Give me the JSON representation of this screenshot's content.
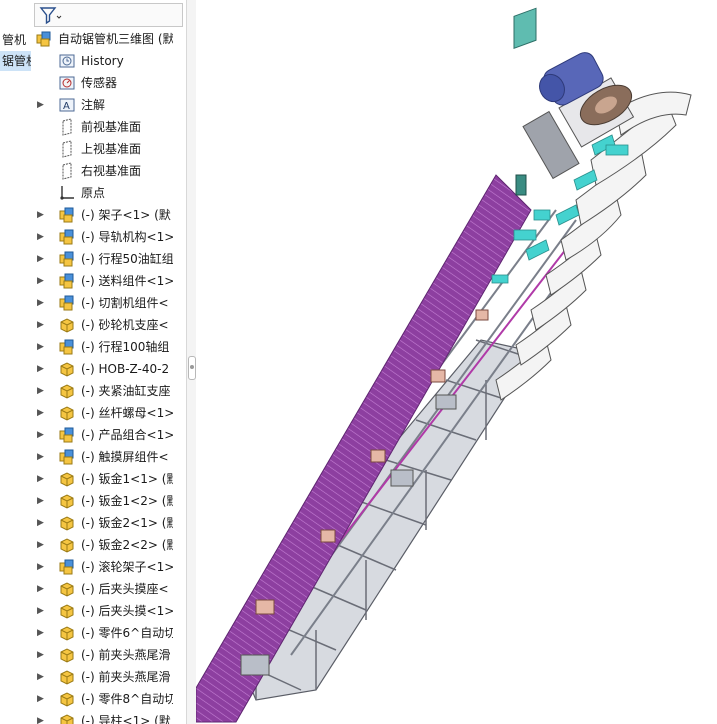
{
  "left_tab": {
    "items": [
      {
        "label": "管机",
        "selected": false
      },
      {
        "label": "锯管机",
        "selected": true
      }
    ]
  },
  "feature_tree": {
    "root": {
      "label": "自动锯管机三维图 (默",
      "icon": "assembly-icon"
    },
    "items": [
      {
        "label": "History",
        "icon": "history-icon",
        "expandable": false
      },
      {
        "label": "传感器",
        "icon": "sensor-icon",
        "expandable": false
      },
      {
        "label": "注解",
        "icon": "annotation-icon",
        "expandable": true
      },
      {
        "label": "前视基准面",
        "icon": "plane-icon",
        "expandable": false
      },
      {
        "label": "上视基准面",
        "icon": "plane-icon",
        "expandable": false
      },
      {
        "label": "右视基准面",
        "icon": "plane-icon",
        "expandable": false
      },
      {
        "label": "原点",
        "icon": "origin-icon",
        "expandable": false
      },
      {
        "label": "(-) 架子<1> (默",
        "icon": "subassembly-icon",
        "expandable": true
      },
      {
        "label": "(-) 导轨机构<1>",
        "icon": "subassembly-icon",
        "expandable": true
      },
      {
        "label": "(-) 行程50油缸组",
        "icon": "subassembly-icon",
        "expandable": true
      },
      {
        "label": "(-) 送料组件<1>",
        "icon": "subassembly-icon",
        "expandable": true
      },
      {
        "label": "(-) 切割机组件<",
        "icon": "subassembly-icon",
        "expandable": true
      },
      {
        "label": "(-) 砂轮机支座<",
        "icon": "part-icon",
        "expandable": true
      },
      {
        "label": "(-) 行程100轴组",
        "icon": "subassembly-icon",
        "expandable": true
      },
      {
        "label": "(-) HOB-Z-40-2",
        "icon": "part-icon",
        "expandable": true
      },
      {
        "label": "(-) 夹紧油缸支座",
        "icon": "part-icon",
        "expandable": true
      },
      {
        "label": "(-) 丝杆螺母<1>",
        "icon": "part-icon",
        "expandable": true
      },
      {
        "label": "(-) 产品组合<1>",
        "icon": "subassembly-icon",
        "expandable": true
      },
      {
        "label": "(-) 触摸屏组件<",
        "icon": "subassembly-icon",
        "expandable": true
      },
      {
        "label": "(-) 钣金1<1> (默",
        "icon": "part-icon",
        "expandable": true
      },
      {
        "label": "(-) 钣金1<2> (默",
        "icon": "part-icon",
        "expandable": true
      },
      {
        "label": "(-) 钣金2<1> (默",
        "icon": "part-icon",
        "expandable": true
      },
      {
        "label": "(-) 钣金2<2> (默",
        "icon": "part-icon",
        "expandable": true
      },
      {
        "label": "(-) 滚轮架子<1>",
        "icon": "subassembly-icon",
        "expandable": true
      },
      {
        "label": "(-) 后夹头摸座<",
        "icon": "part-icon",
        "expandable": true
      },
      {
        "label": "(-) 后夹头摸<1>",
        "icon": "part-icon",
        "expandable": true
      },
      {
        "label": "(-) 零件6^自动切",
        "icon": "part-icon",
        "expandable": true
      },
      {
        "label": "(-) 前夹头燕尾滑",
        "icon": "part-icon",
        "expandable": true
      },
      {
        "label": "(-) 前夹头燕尾滑",
        "icon": "part-icon",
        "expandable": true
      },
      {
        "label": "(-) 零件8^自动切",
        "icon": "part-icon",
        "expandable": true
      },
      {
        "label": "(-) 导柱<1> (默",
        "icon": "part-icon",
        "expandable": true
      }
    ]
  },
  "colors": {
    "selection": "#cde3f7",
    "part_yellow": "#f5c542",
    "assembly_blue": "#4a90d9",
    "material_purple": "#8d3fa0",
    "frame_gray": "#c9ccd4",
    "cyan_accent": "#44d2cf"
  },
  "viewport": {
    "model": "自动锯管机三维图"
  }
}
